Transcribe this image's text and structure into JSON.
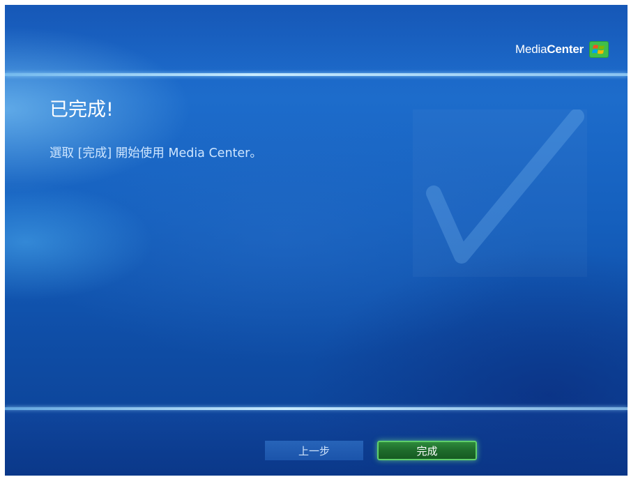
{
  "app": {
    "logo_prefix": "Media",
    "logo_suffix": "Center",
    "logo_icon": "windows-flag-icon"
  },
  "page": {
    "title": "已完成!",
    "instruction": "選取 [完成] 開始使用 Media Center。",
    "background_icon": "checkmark-icon"
  },
  "buttons": {
    "back_label": "上一步",
    "done_label": "完成"
  },
  "colors": {
    "accent_green": "#1e6b2b",
    "background_blue": "#1560be",
    "text_light": "#cfe6ff"
  }
}
